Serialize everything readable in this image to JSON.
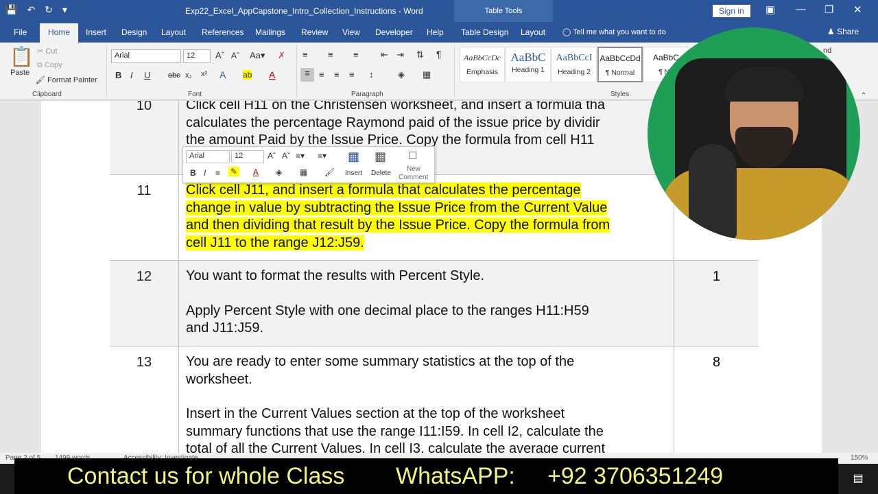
{
  "titlebar": {
    "doc_title": "Exp22_Excel_AppCapstone_Intro_Collection_Instructions - Word",
    "table_tools": "Table Tools",
    "sign_in": "Sign in"
  },
  "tabs": [
    "File",
    "Home",
    "Insert",
    "Design",
    "Layout",
    "References",
    "Mailings",
    "Review",
    "View",
    "Developer",
    "Help",
    "Table Design",
    "Layout"
  ],
  "active_tab": "Home",
  "tell_me": "Tell me what you want to do",
  "share": "Share",
  "ribbon": {
    "clipboard": {
      "paste": "Paste",
      "cut": "Cut",
      "copy": "Copy",
      "format_painter": "Format Painter",
      "label": "Clipboard"
    },
    "font": {
      "name": "Arial",
      "size": "12",
      "label": "Font"
    },
    "paragraph": {
      "label": "Paragraph"
    },
    "styles": {
      "label": "Styles",
      "items": [
        {
          "preview": "AaBbCcDc",
          "name": "Emphasis"
        },
        {
          "preview": "AaBbC",
          "name": "Heading 1"
        },
        {
          "preview": "AaBbCcI",
          "name": "Heading 2"
        },
        {
          "preview": "AaBbCcDd",
          "name": "¶ Normal"
        },
        {
          "preview": "AaBbC",
          "name": "¶ No"
        }
      ]
    },
    "editing": {
      "find": "nd",
      "replace": "ace"
    }
  },
  "mini_toolbar": {
    "font": "Arial",
    "size": "12",
    "insert": "Insert",
    "delete": "Delete",
    "new_comment_1": "New",
    "new_comment_2": "Comment"
  },
  "document": {
    "rows": [
      {
        "num": "10",
        "lines": [
          "Click cell H11 on the Christensen worksheet, and insert a formula tha",
          "calculates the percentage Raymond paid of the issue price by dividir",
          "the amount Paid by the Issue Price. Copy the formula from cell H11"
        ],
        "points": ""
      },
      {
        "num": "11",
        "lines": [
          "Click cell J11, and insert a formula that calculates the percentage",
          "change in value by subtracting the Issue Price from the Current Value",
          "and then dividing that result by the Issue Price. Copy the formula from",
          "cell J11 to the range J12:J59."
        ],
        "points": ""
      },
      {
        "num": "12",
        "p1": "You want to format the results with Percent Style.",
        "p2_lines": [
          "Apply Percent Style with one decimal place to the ranges H11:H59",
          "and J11:J59."
        ],
        "points": "1"
      },
      {
        "num": "13",
        "p1_lines": [
          "You are ready to enter some summary statistics at the top of the",
          "worksheet."
        ],
        "p2_lines": [
          "Insert in the Current Values section at the top of the worksheet",
          "summary functions that use the range I11:I59. In cell I2, calculate the",
          "total of all the Current Values. In cell I3, calculate the average current"
        ],
        "points": "8"
      }
    ]
  },
  "status": {
    "page": "Page 2 of 5",
    "words": "1499 words",
    "accessibility": "Accessibility: Investigate",
    "zoom": "150%"
  },
  "banner": {
    "contact": "Contact us for whole Class",
    "whatsapp": "WhatsAPP:",
    "phone": "+92 3706351249"
  }
}
